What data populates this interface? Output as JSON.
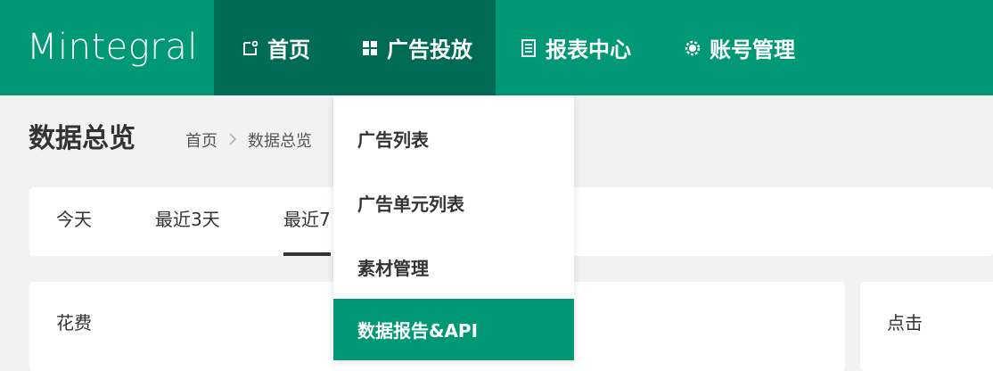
{
  "brand": {
    "logo_text": "Mintegral"
  },
  "nav": {
    "home": "首页",
    "ads": "广告投放",
    "reports": "报表中心",
    "account": "账号管理"
  },
  "page": {
    "title": "数据总览",
    "breadcrumb": [
      "首页",
      "数据总览"
    ],
    "breadcrumb_separator": ">"
  },
  "date_tabs": [
    "今天",
    "最近3天",
    "最近7"
  ],
  "metrics": {
    "spend_label": "花费",
    "clicks_label": "点击"
  },
  "ads_dropdown": {
    "items": [
      "广告列表",
      "广告单元列表",
      "素材管理",
      "数据报告&API"
    ],
    "active_index": 3
  },
  "colors": {
    "brand_green": "#009875",
    "nav_active": "#006c55",
    "background": "#f2f2f2"
  },
  "icons": {
    "home": "home-icon",
    "ads": "grid-icon",
    "reports": "document-icon",
    "account": "gear-icon"
  }
}
